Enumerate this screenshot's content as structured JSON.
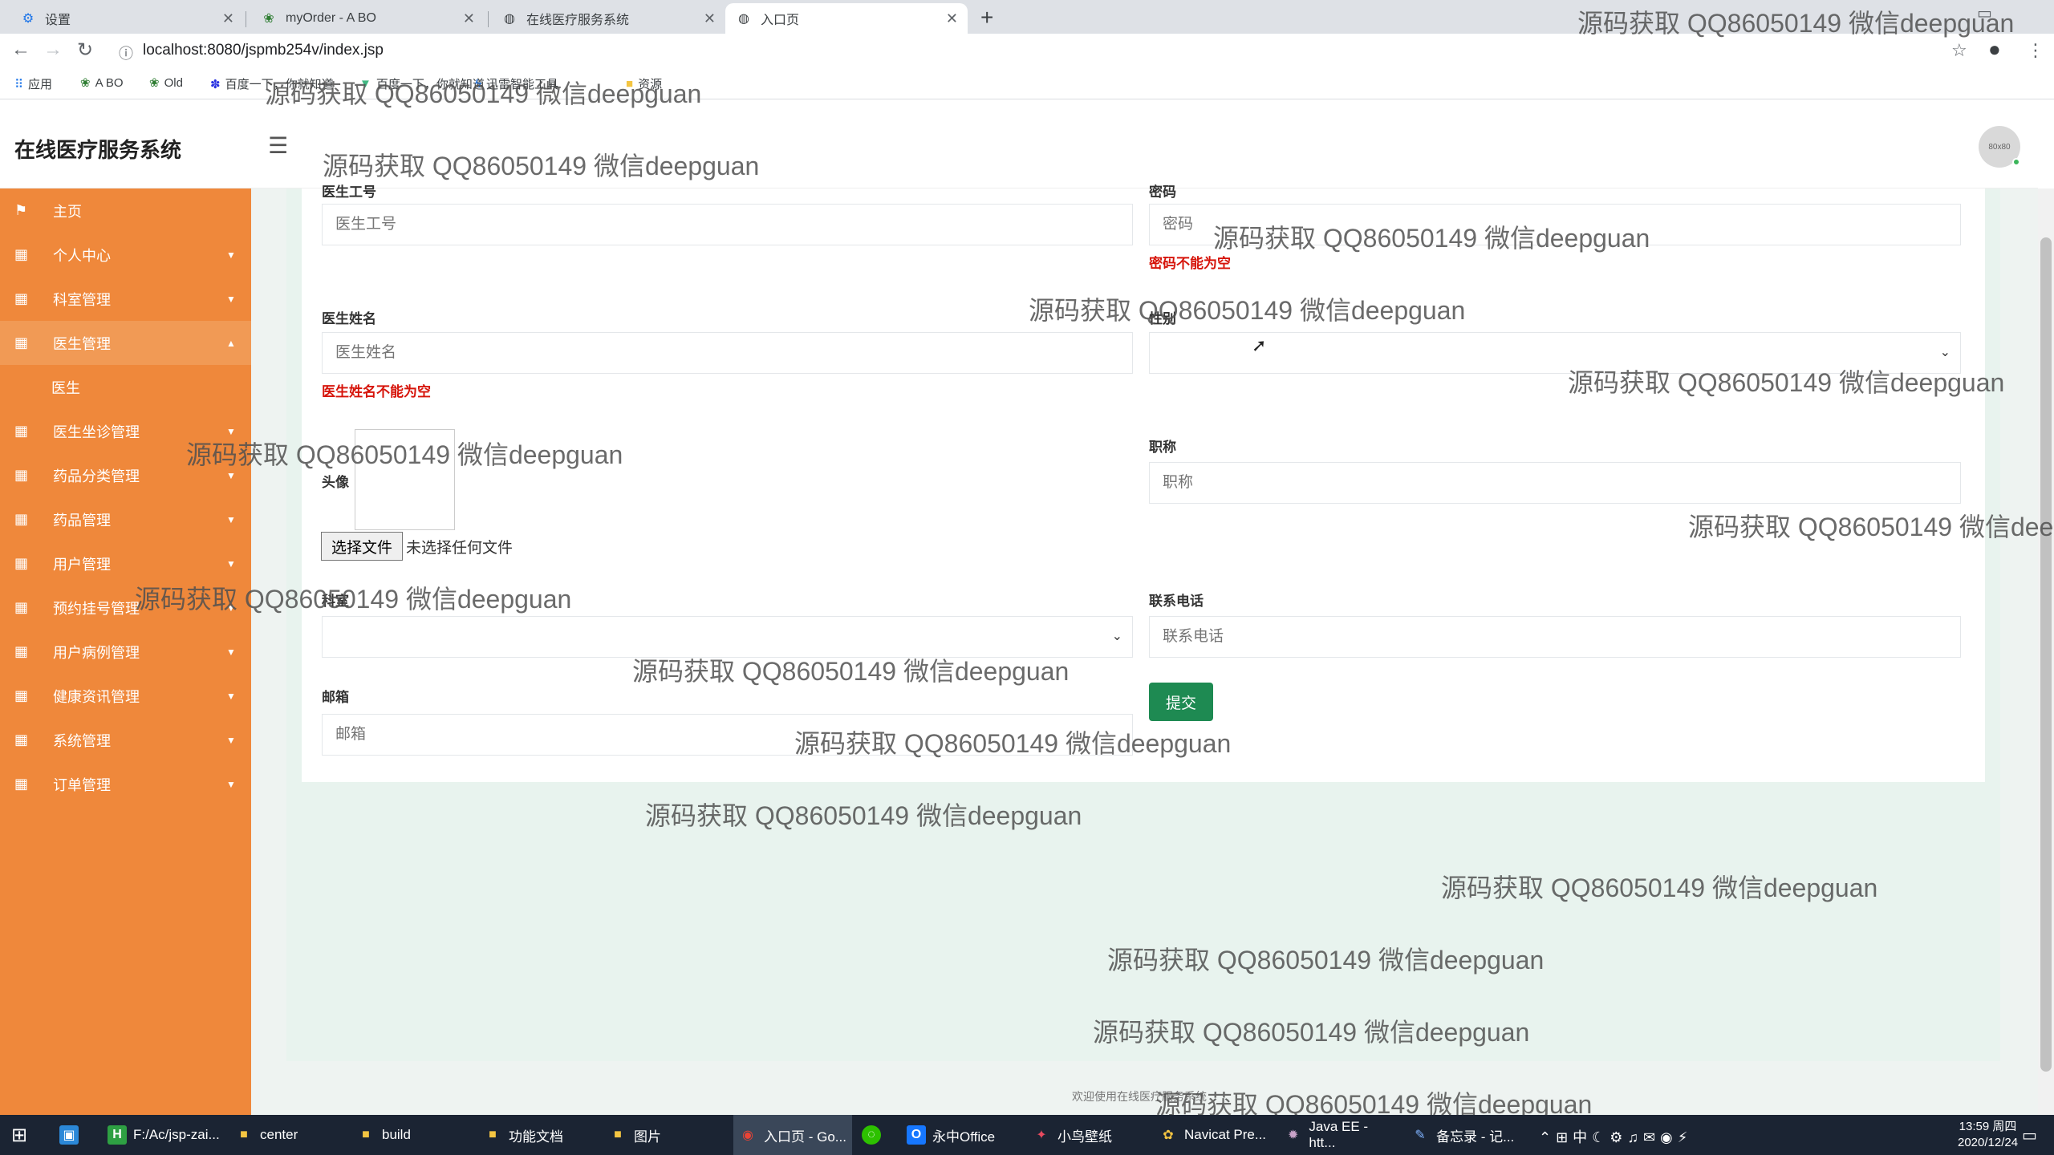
{
  "browser": {
    "tabs": [
      {
        "title": "设置",
        "icon": "gear-icon"
      },
      {
        "title": "myOrder - A BO",
        "icon": "leaf-icon"
      },
      {
        "title": "在线医疗服务系统",
        "icon": "globe-icon"
      },
      {
        "title": "入口页",
        "icon": "globe-icon",
        "active": true
      }
    ],
    "url": "localhost:8080/jspmb254v/index.jsp",
    "bookmarks": [
      {
        "label": "应用",
        "icon": "apps-grid-icon"
      },
      {
        "label": "A BO",
        "icon": "leaf-icon"
      },
      {
        "label": "Old",
        "icon": "leaf-icon"
      },
      {
        "label": "百度一下，你就知道",
        "icon": "baidu-paw-icon"
      },
      {
        "label": "百度一下，你就知道",
        "icon": "vue-icon"
      },
      {
        "label": "迅雷智能工具",
        "icon": "thunder-icon"
      },
      {
        "label": "资源",
        "icon": "folder-icon"
      }
    ]
  },
  "header": {
    "brand": "在线医疗服务系统",
    "avatar_text": "80x80"
  },
  "sidebar": {
    "items": [
      {
        "label": "主页",
        "icon": "flag-icon",
        "caret": ""
      },
      {
        "label": "个人中心",
        "icon": "grid-icon",
        "caret": "▼"
      },
      {
        "label": "科室管理",
        "icon": "grid-icon",
        "caret": "▼"
      },
      {
        "label": "医生管理",
        "icon": "grid-icon",
        "caret": "▲"
      },
      {
        "label": "医生坐诊管理",
        "icon": "grid-icon",
        "caret": "▼"
      },
      {
        "label": "药品分类管理",
        "icon": "grid-icon",
        "caret": "▼"
      },
      {
        "label": "药品管理",
        "icon": "grid-icon",
        "caret": "▼"
      },
      {
        "label": "用户管理",
        "icon": "grid-icon",
        "caret": "▼"
      },
      {
        "label": "预约挂号管理",
        "icon": "grid-icon",
        "caret": "▼"
      },
      {
        "label": "用户病例管理",
        "icon": "grid-icon",
        "caret": "▼"
      },
      {
        "label": "健康资讯管理",
        "icon": "grid-icon",
        "caret": "▼"
      },
      {
        "label": "系统管理",
        "icon": "grid-icon",
        "caret": "▼"
      },
      {
        "label": "订单管理",
        "icon": "grid-icon",
        "caret": "▼"
      }
    ],
    "sub_item": "医生"
  },
  "form": {
    "doctor_id": {
      "label": "医生工号",
      "placeholder": "医生工号"
    },
    "password": {
      "label": "密码",
      "placeholder": "密码",
      "error": "密码不能为空"
    },
    "doctor_name": {
      "label": "医生姓名",
      "placeholder": "医生姓名",
      "error": "医生姓名不能为空"
    },
    "gender": {
      "label": "性别",
      "value": ""
    },
    "avatar": {
      "label": "头像",
      "button": "选择文件",
      "status": "未选择任何文件"
    },
    "title": {
      "label": "职称",
      "placeholder": "职称"
    },
    "department": {
      "label": "科室",
      "value": ""
    },
    "phone": {
      "label": "联系电话",
      "placeholder": "联系电话"
    },
    "email": {
      "label": "邮箱",
      "placeholder": "邮箱"
    },
    "submit": "提交"
  },
  "footer": {
    "text": "欢迎使用在线医疗服务系统"
  },
  "watermark": "源码获取 QQ86050149 微信deepguan",
  "taskbar": {
    "items": [
      {
        "label": "F:/Ac/jsp-zai...",
        "icon": "H"
      },
      {
        "label": "center",
        "icon": "folder-icon"
      },
      {
        "label": "build",
        "icon": "folder-icon"
      },
      {
        "label": "功能文档",
        "icon": "folder-icon"
      },
      {
        "label": "图片",
        "icon": "folder-icon"
      },
      {
        "label": "入口页 - Go...",
        "icon": "chrome-icon",
        "active": true
      },
      {
        "label": "",
        "icon": "wechat-icon"
      },
      {
        "label": "永中Office",
        "icon": "office-icon"
      },
      {
        "label": "小鸟壁纸",
        "icon": "bird-icon"
      },
      {
        "label": "Navicat Pre...",
        "icon": "navicat-icon"
      },
      {
        "label": "Java EE - htt...",
        "icon": "eclipse-icon"
      },
      {
        "label": "备忘录 - 记...",
        "icon": "notepad-icon"
      }
    ],
    "ime": "中",
    "time": "13:59 周四",
    "date": "2020/12/24"
  },
  "colors": {
    "sidebar": "#ef883b",
    "sidebar_active": "#f19a55",
    "submit": "#1e8a52",
    "error": "#d6140a",
    "content_bg": "#e8f3ee"
  }
}
